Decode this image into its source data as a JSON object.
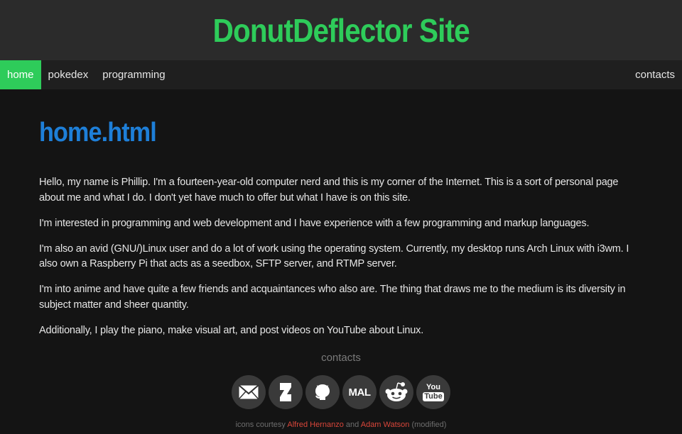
{
  "site": {
    "title": "DonutDeflector Site"
  },
  "nav": {
    "items": [
      {
        "label": "home",
        "active": true
      },
      {
        "label": "pokedex"
      },
      {
        "label": "programming"
      }
    ],
    "right": {
      "label": "contacts"
    }
  },
  "main": {
    "heading": "home.html",
    "paragraphs": [
      "Hello, my name is Phillip. I'm a fourteen-year-old computer nerd and this is my corner of the Internet. This is a sort of personal page about me and what I do. I don't yet have much to offer but what I have is on this site.",
      "I'm interested in programming and web development and I have experience with a few programming and markup languages.",
      "I'm also an avid (GNU/)Linux user and do a lot of work using the operating system. Currently, my desktop runs Arch Linux with i3wm. I also own a Raspberry Pi that acts as a seedbox, SFTP server, and RTMP server.",
      "I'm into anime and have quite a few friends and acquaintances who also are. The thing that draws me to the medium is its diversity in subject matter and sheer quantity.",
      "Additionally, I play the piano, make visual art, and post videos on YouTube about Linux."
    ]
  },
  "contacts": {
    "heading": "contacts",
    "icons": [
      "mail-icon",
      "deviantart-icon",
      "github-icon",
      "myanimelist-icon",
      "reddit-icon",
      "youtube-icon"
    ],
    "mal_text": "MAL",
    "yt_top": "You",
    "yt_bottom": "Tube"
  },
  "credits": {
    "prefix": "icons courtesy",
    "author1": "Alfred Hernanzo",
    "and": "and",
    "author2": "Adam Watson",
    "suffix": "(modified)"
  },
  "colors": {
    "accent_green": "#2ecc5a",
    "heading_blue": "#1e7fd8",
    "link_red": "#d9463a",
    "background": "#141414"
  }
}
